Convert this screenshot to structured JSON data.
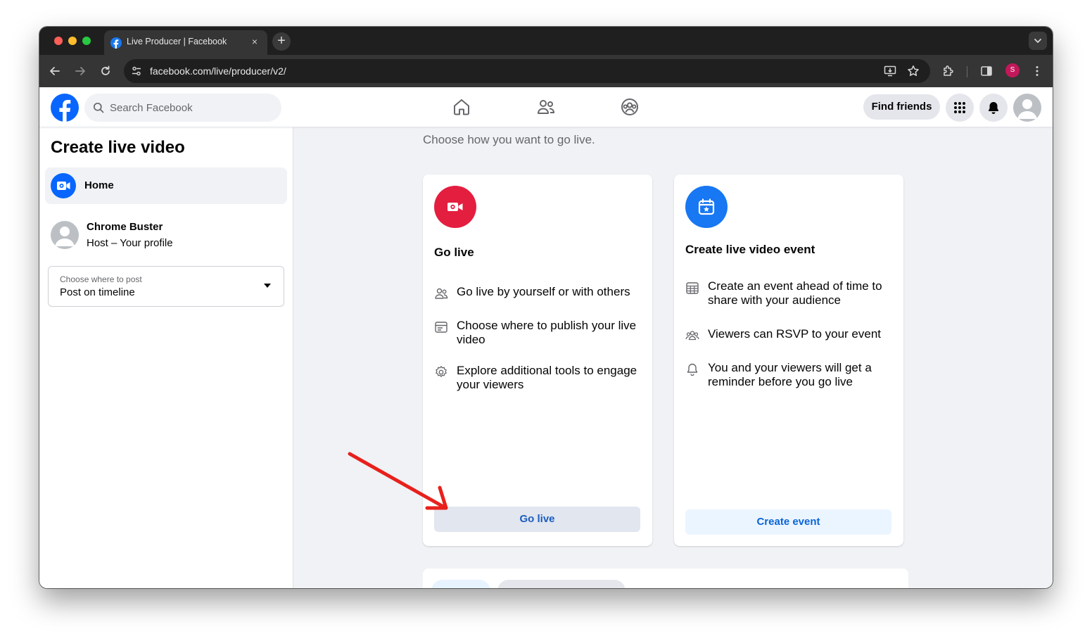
{
  "browser": {
    "tab_title": "Live Producer | Facebook",
    "tab_close": "×",
    "new_tab": "+",
    "url": "facebook.com/live/producer/v2/",
    "profile_initial": "S"
  },
  "header": {
    "search_placeholder": "Search Facebook",
    "find_friends_label": "Find friends"
  },
  "sidebar": {
    "title": "Create live video",
    "home_label": "Home",
    "host_name": "Chrome Buster",
    "host_role": "Host – Your profile",
    "post_select": {
      "label": "Choose where to post",
      "value": "Post on timeline"
    }
  },
  "main": {
    "subtitle": "Choose how you want to go live.",
    "go_live_card": {
      "title": "Go live",
      "features": [
        {
          "icon": "people-icon",
          "text": "Go live by yourself or with others"
        },
        {
          "icon": "browser-window-icon",
          "text": "Choose where to publish your live video"
        },
        {
          "icon": "gear-icon",
          "text": "Explore additional tools to engage your viewers"
        }
      ],
      "button_label": "Go live"
    },
    "event_card": {
      "title": "Create live video event",
      "features": [
        {
          "icon": "calendar-grid-icon",
          "text": "Create an event ahead of time to share with your audience"
        },
        {
          "icon": "group-icon",
          "text": "Viewers can RSVP to your event"
        },
        {
          "icon": "bell-icon",
          "text": "You and your viewers will get a reminder before you go live"
        }
      ],
      "button_label": "Create event"
    }
  },
  "colors": {
    "facebook_blue": "#0866ff",
    "go_live_red": "#e41e3f",
    "event_blue": "#1877f2",
    "annotation_arrow": "#e8201c"
  }
}
